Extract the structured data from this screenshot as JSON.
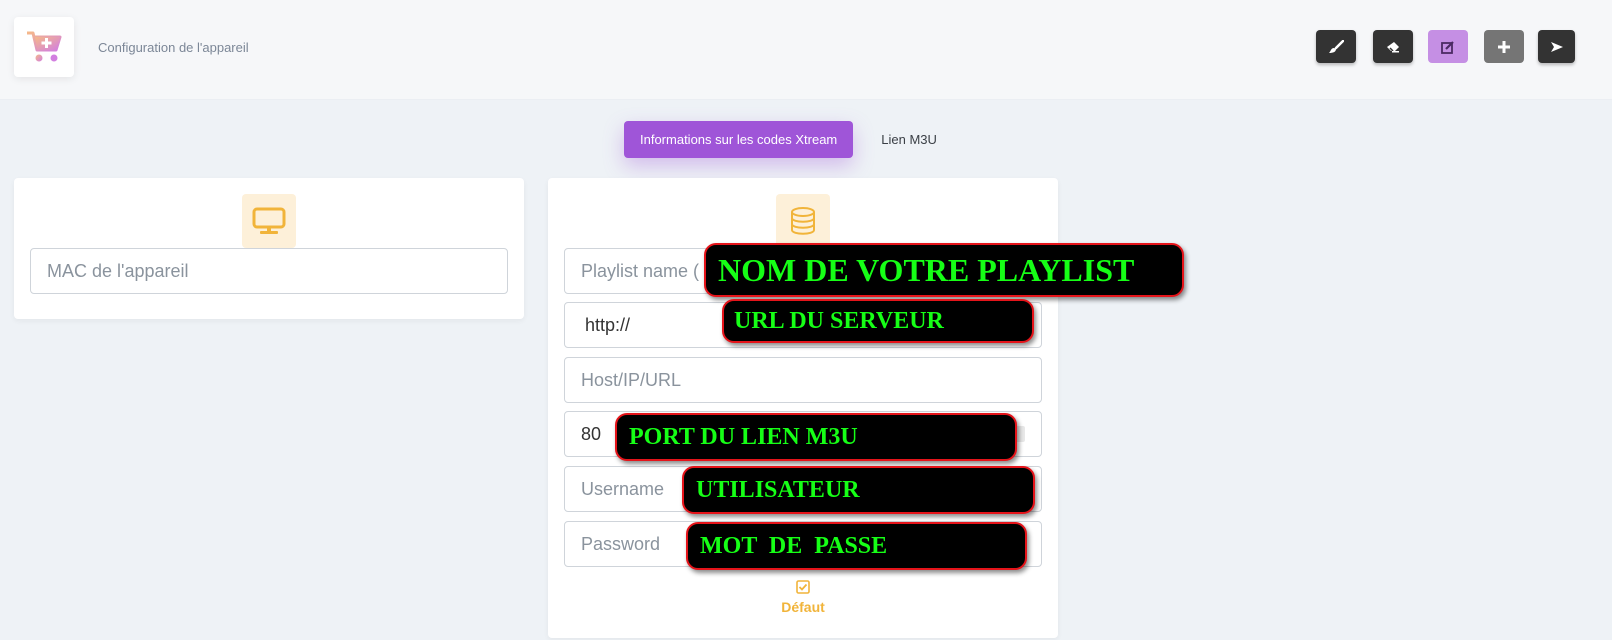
{
  "header": {
    "title": "Configuration de l'appareil",
    "logo_icon": "cart-plus-icon",
    "tools": [
      {
        "name": "brush-icon",
        "style": "dark"
      },
      {
        "name": "eraser-icon",
        "style": "dark"
      },
      {
        "name": "edit-icon",
        "style": "purple"
      },
      {
        "name": "plus-icon",
        "style": "grey"
      },
      {
        "name": "send-icon",
        "style": "dark"
      }
    ]
  },
  "tabs": {
    "active": "Informations sur les codes Xtream",
    "other": "Lien M3U"
  },
  "device_card": {
    "icon": "monitor-icon",
    "mac_placeholder": "MAC de l'appareil"
  },
  "xtream_card": {
    "icon": "database-icon",
    "playlist_placeholder": "Playlist name (",
    "protocol_value": "http://",
    "host_placeholder": "Host/IP/URL",
    "port_value": "80",
    "username_placeholder": "Username",
    "password_placeholder": "Password",
    "default_label": "Défaut",
    "default_icon": "checkbox-checked-icon"
  },
  "annotations": {
    "playlist": "NOM DE VOTRE PLAYLIST",
    "server_url": "URL DU SERVEUR",
    "port": "PORT DU LIEN M3U",
    "user": "UTILISATEUR",
    "password": "MOT  DE  PASSE"
  },
  "colors": {
    "accent_purple": "#9f55d8",
    "accent_orange": "#f1b43a",
    "annotation_text": "#16ff16",
    "annotation_border": "#e5141a"
  }
}
